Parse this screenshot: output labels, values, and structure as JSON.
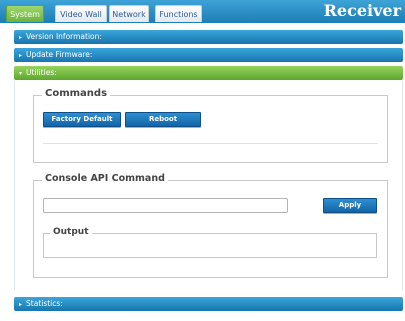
{
  "tabs": [
    {
      "label": "System",
      "active": true
    },
    {
      "label": "Video Wall",
      "active": false
    },
    {
      "label": "Network",
      "active": false
    },
    {
      "label": "Functions",
      "active": false
    }
  ],
  "brand": "Receiver",
  "sections": {
    "version": "Version Information:",
    "firmware": "Update Firmware:",
    "utilities": "Utilities:",
    "statistics": "Statistics:"
  },
  "carets": {
    "collapsed": "▸",
    "expanded": "▾"
  },
  "commands": {
    "legend": "Commands",
    "factory_default": "Factory Default",
    "reboot": "Reboot"
  },
  "console": {
    "legend": "Console API Command",
    "input_value": "",
    "apply": "Apply",
    "output_legend": "Output",
    "output_text": ""
  },
  "colors": {
    "header_blue": "#1d7db5",
    "active_green": "#6ab33a",
    "button_blue": "#1165a6"
  }
}
